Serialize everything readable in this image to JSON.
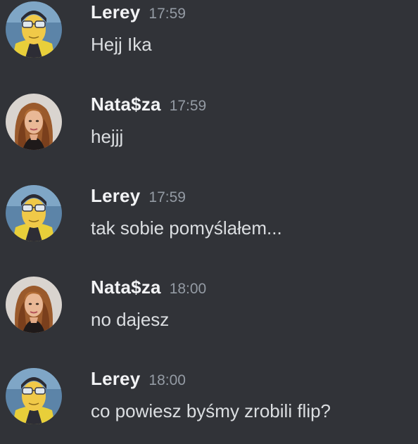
{
  "colors": {
    "background": "#313338",
    "author": "#f2f3f5",
    "timestamp": "#949ba4",
    "message_text": "#dbdee1"
  },
  "messages": [
    {
      "author": "Lerey",
      "time": "17:59",
      "text": "Hejj Ika",
      "avatar": "yellow-hero-avatar"
    },
    {
      "author": "Nata$za",
      "time": "17:59",
      "text": "hejjj",
      "avatar": "woman-portrait-avatar"
    },
    {
      "author": "Lerey",
      "time": "17:59",
      "text": "tak sobie pomyślałem...",
      "avatar": "yellow-hero-avatar"
    },
    {
      "author": "Nata$za",
      "time": "18:00",
      "text": "no dajesz",
      "avatar": "woman-portrait-avatar"
    },
    {
      "author": "Lerey",
      "time": "18:00",
      "text": "co powiesz byśmy zrobili flip?",
      "avatar": "yellow-hero-avatar"
    }
  ]
}
